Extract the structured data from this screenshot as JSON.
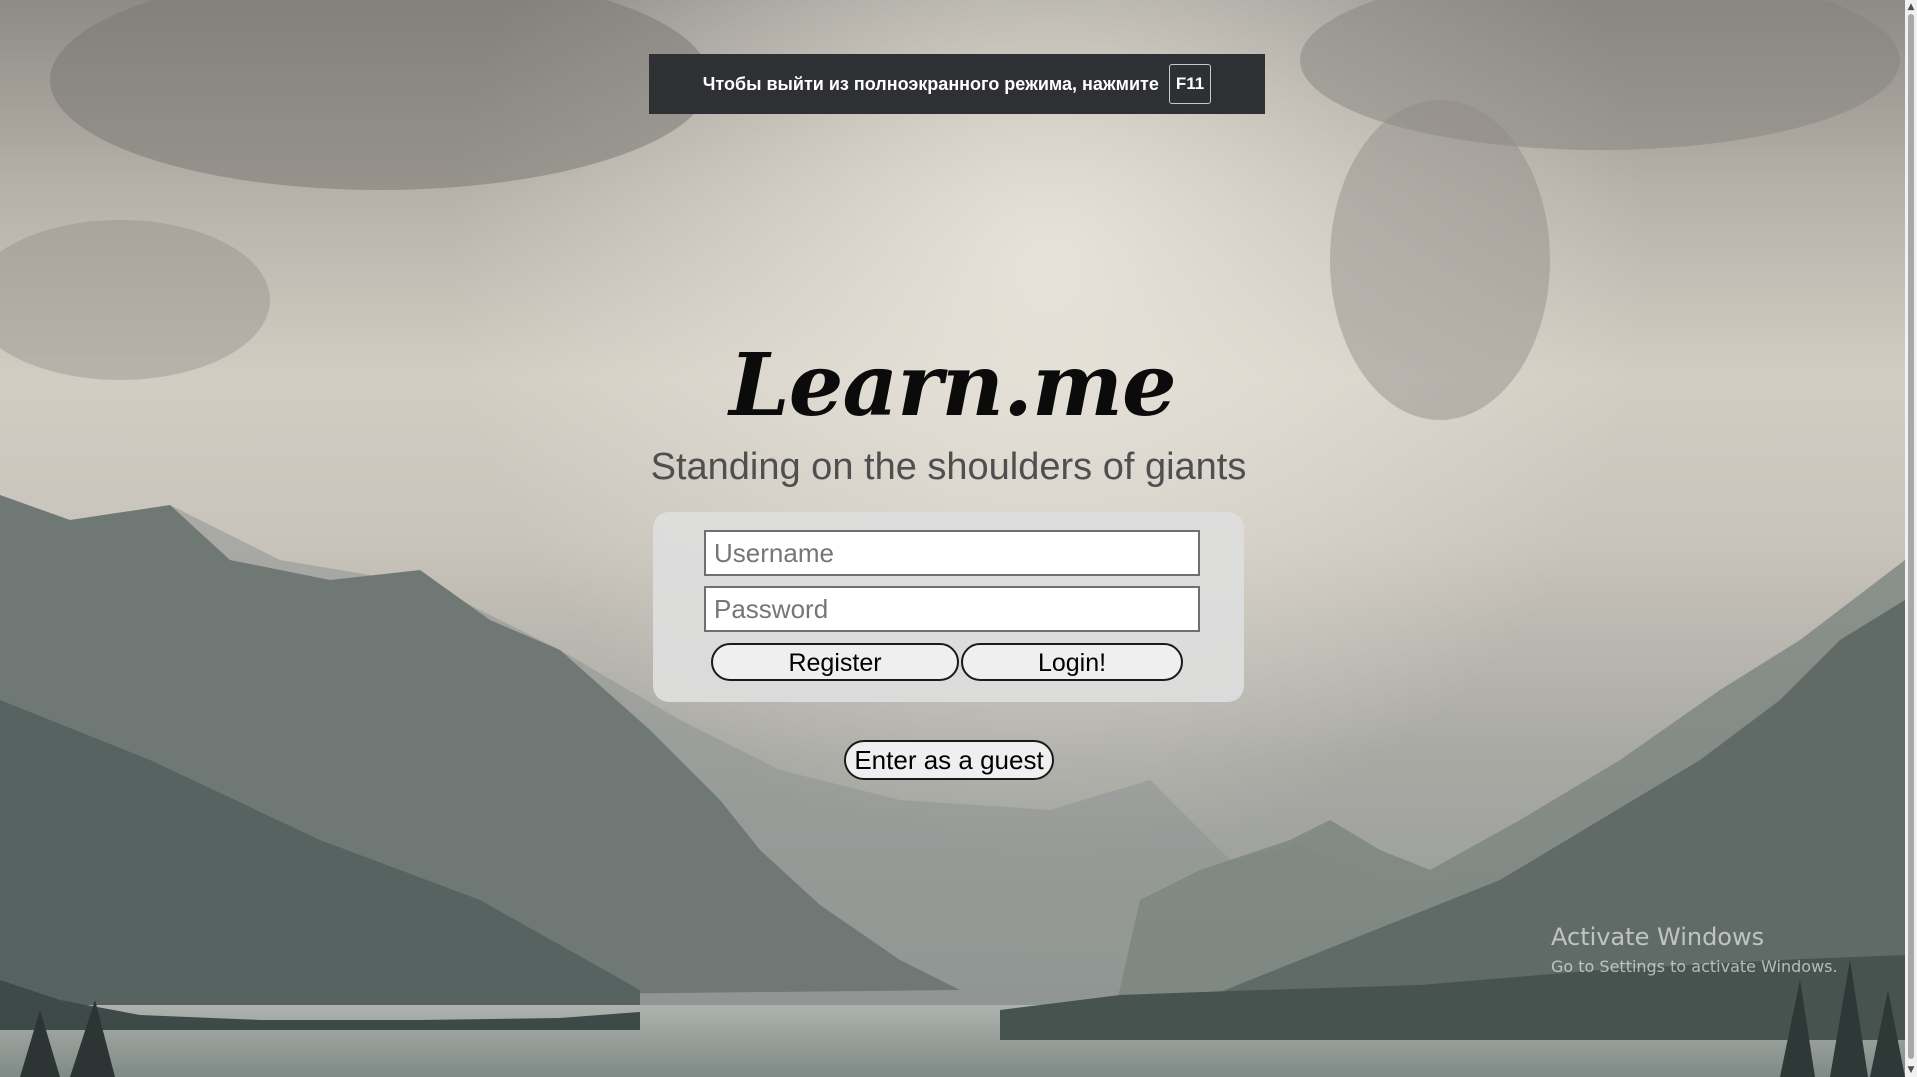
{
  "fullscreen_notice": {
    "text": "Чтобы выйти из полноэкранного режима, нажмите",
    "key": "F11"
  },
  "app": {
    "logo": "Learn.me",
    "tagline": "Standing on the shoulders of giants"
  },
  "login_form": {
    "username_placeholder": "Username",
    "password_placeholder": "Password",
    "register_label": "Register",
    "login_label": "Login!"
  },
  "guest_button_label": "Enter as a guest",
  "watermark": {
    "title": "Activate Windows",
    "subtitle": "Go to Settings to activate Windows."
  },
  "scrollbar": {
    "up_arrow": "▲",
    "down_arrow": "▼"
  }
}
